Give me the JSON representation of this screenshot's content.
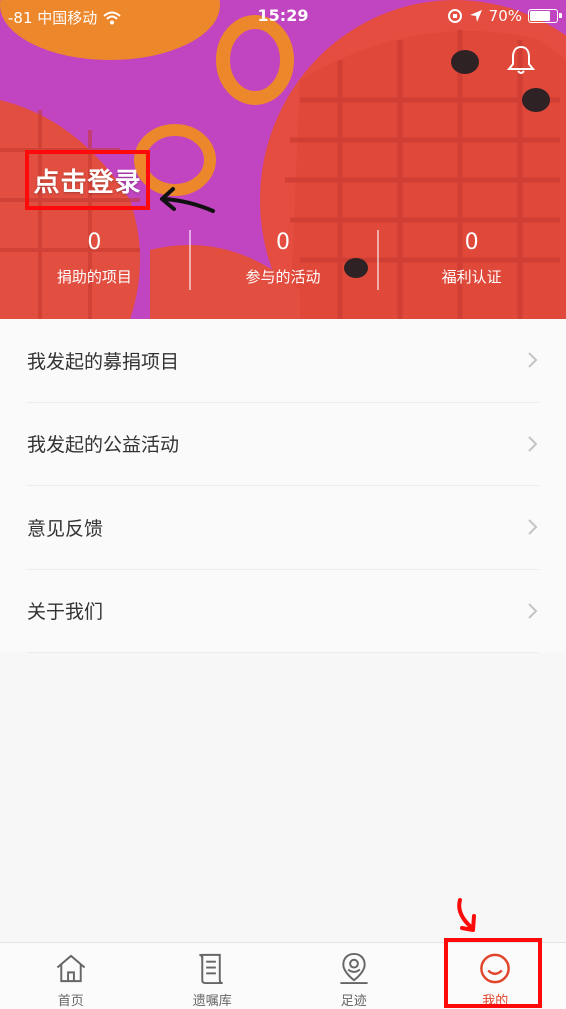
{
  "status_bar": {
    "signal": "-81 中国移动",
    "time": "15:29",
    "battery": "70%"
  },
  "header": {
    "login_label": "点击登录",
    "stats": [
      {
        "value": "0",
        "label": "捐助的项目"
      },
      {
        "value": "0",
        "label": "参与的活动"
      },
      {
        "value": "0",
        "label": "福利认证"
      }
    ]
  },
  "menu": {
    "items": [
      {
        "label": "我发起的募捐项目"
      },
      {
        "label": "我发起的公益活动"
      },
      {
        "label": "意见反馈"
      },
      {
        "label": "关于我们"
      }
    ]
  },
  "tabbar": {
    "tabs": [
      {
        "label": "首页",
        "icon": "home-icon"
      },
      {
        "label": "遗嘱库",
        "icon": "scroll-icon"
      },
      {
        "label": "足迹",
        "icon": "location-pin-icon"
      },
      {
        "label": "我的",
        "icon": "profile-icon"
      }
    ],
    "active_index": 3
  },
  "colors": {
    "annotation_red": "#ff0a0a",
    "active_tab": "#e0452b",
    "header_purple": "#c84ad0"
  }
}
